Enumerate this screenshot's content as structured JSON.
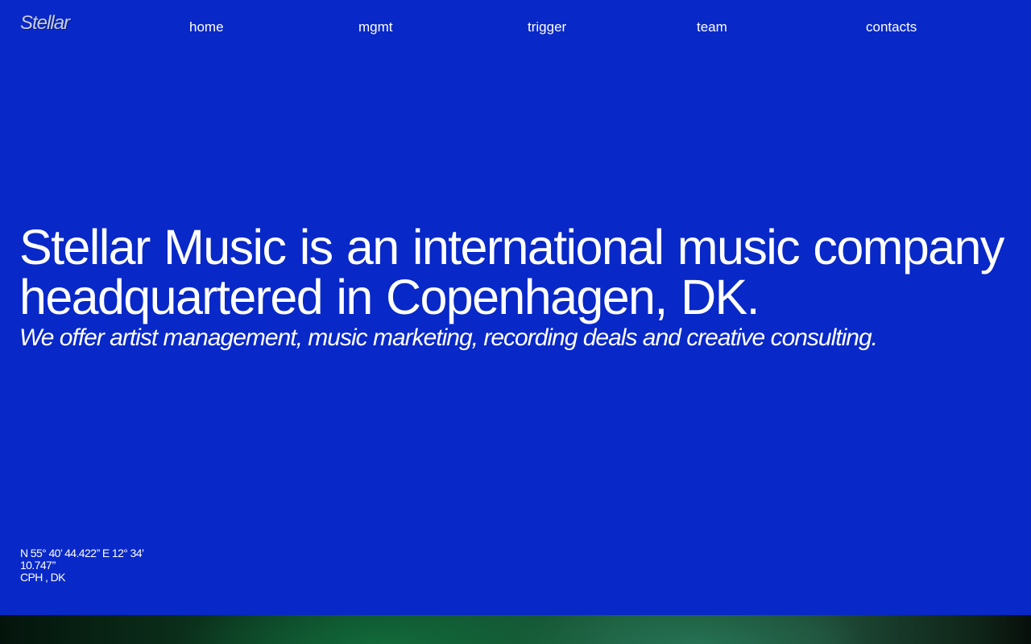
{
  "header": {
    "logo": "Stellar",
    "nav": [
      "home",
      "mgmt",
      "trigger",
      "team",
      "contacts"
    ]
  },
  "hero": {
    "title": "Stellar Music is an international music company headquartered in Copenhagen, DK.",
    "subtitle": "We offer artist management, music marketing, recording deals and creative consulting."
  },
  "location": {
    "coordinates": "N 55° 40’ 44.422’’ E 12° 34’ 10.747’’",
    "city": "CPH , DK"
  },
  "colors": {
    "background": "#0828c8",
    "text": "#ffffff",
    "footer_band": "#0e4a2a"
  }
}
